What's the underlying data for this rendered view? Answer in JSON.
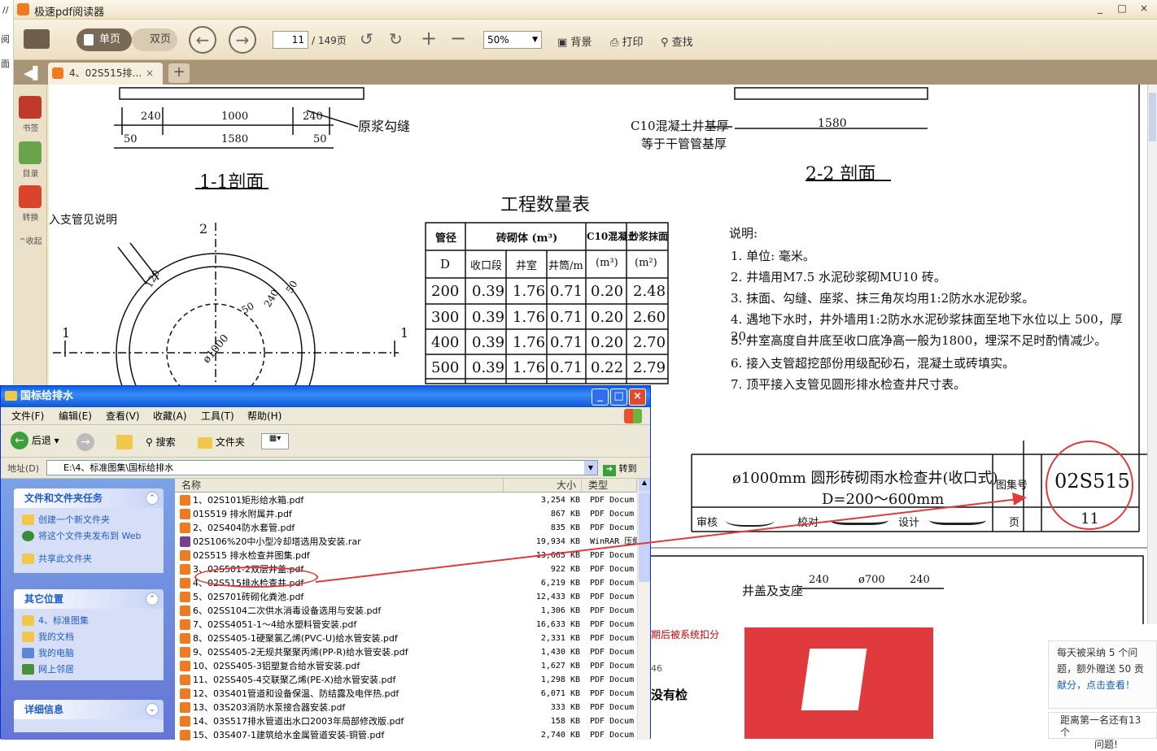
{
  "left_strip": {
    "chars": [
      "//",
      "阅",
      "面"
    ]
  },
  "reader": {
    "title": "极速pdf阅读器",
    "win_controls": [
      "_",
      "□",
      "×"
    ],
    "toolbar": {
      "single": "单页",
      "double": "双页",
      "page_current": "11",
      "page_total": "/ 149页",
      "zoom": "50%",
      "background": "背景",
      "print": "打印",
      "find": "查找"
    },
    "tab": {
      "label": "4、02S515排…",
      "close": "×",
      "add": "+"
    },
    "sidebar": [
      {
        "label": "书签"
      },
      {
        "label": "目录"
      },
      {
        "label": "转换"
      }
    ],
    "sidebar_collapse": "^收起"
  },
  "drawing": {
    "dims_left": [
      "240",
      "1000",
      "240",
      "50",
      "1580",
      "50"
    ],
    "left_note": "原浆勾缝",
    "left_section": "1-1剖面",
    "right_note1": "C10混凝土井基厚",
    "right_note2": "等于干管管基厚",
    "right_dim": "1580",
    "right_section": "2-2 剖面",
    "table_title": "工程数量表",
    "table_head": [
      "管径",
      "砖砌体 (m³)",
      "C10混凝土",
      "砂浆抹面"
    ],
    "table_sub": [
      "D",
      "收口段",
      "井室",
      "井筒/m",
      "(m³)",
      "(m²)"
    ],
    "table_rows": [
      [
        "200",
        "0.39",
        "1.76",
        "0.71",
        "0.20",
        "2.48"
      ],
      [
        "300",
        "0.39",
        "1.76",
        "0.71",
        "0.20",
        "2.60"
      ],
      [
        "400",
        "0.39",
        "1.76",
        "0.71",
        "0.20",
        "2.70"
      ],
      [
        "500",
        "0.39",
        "1.76",
        "0.71",
        "0.22",
        "2.79"
      ]
    ],
    "notes_title": "说明:",
    "notes": [
      "1. 单位: 毫米。",
      "2. 井墙用M7.5 水泥砂浆砌MU10 砖。",
      "3. 抹面、勾缝、座浆、抹三角灰均用1:2防水水泥砂浆。",
      "4. 遇地下水时，井外墙用1:2防水水泥砂浆抹面至地下水位以上 500，厚20。",
      "5. 井室高度自井底至收口底净高一般为1800，埋深不足时酌情减少。",
      "6. 接入支管超挖部份用级配砂石，混凝土或砖填实。",
      "7. 顶平接入支管见圆形排水检查井尺寸表。"
    ],
    "branch_note": "入支管见说明",
    "marks": [
      "1",
      "1",
      "2"
    ],
    "plan_labels": [
      "ø1000",
      "50",
      "240",
      "50",
      "30",
      "120"
    ],
    "titleblock": {
      "name": "ø1000mm 圆形砖砌雨水检查井(收口式)",
      "range": "D=200～600mm",
      "atlas_label": "图集号",
      "atlas_no": "02S515",
      "review": "审核",
      "check": "校对",
      "design": "设计",
      "page_label": "页",
      "page_no": "11"
    },
    "next_page": {
      "label": "井盖及支座",
      "dims": [
        "240",
        "ø700",
        "240"
      ]
    }
  },
  "explorer": {
    "title": "国标给排水",
    "menu": [
      "文件(F)",
      "编辑(E)",
      "查看(V)",
      "收藏(A)",
      "工具(T)",
      "帮助(H)"
    ],
    "back": "后退",
    "search": "搜索",
    "folders": "文件夹",
    "addr_label": "地址(D)",
    "addr_value": "E:\\4、标准图集\\国标给排水",
    "go": "转到",
    "tasks_title": "文件和文件夹任务",
    "tasks": [
      "创建一个新文件夹",
      "将这个文件夹发布到 Web",
      "共享此文件夹"
    ],
    "places_title": "其它位置",
    "places": [
      "4、标准图集",
      "我的文档",
      "我的电脑",
      "网上邻居"
    ],
    "details_title": "详细信息",
    "cols": [
      "名称",
      "大小",
      "类型"
    ],
    "files": [
      {
        "name": "1、02S101矩形给水箱.pdf",
        "size": "3,254 KB",
        "type": "PDF Docum"
      },
      {
        "name": "01S519 排水附属井.pdf",
        "size": "867 KB",
        "type": "PDF Docum"
      },
      {
        "name": "2、02S404防水套管.pdf",
        "size": "835 KB",
        "type": "PDF Docum"
      },
      {
        "name": "02S106%20中小型冷却塔选用及安装.rar",
        "size": "19,934 KB",
        "type": "WinRAR 压缩"
      },
      {
        "name": "02S515 排水检查井图集.pdf",
        "size": "13,665 KB",
        "type": "PDF Docum"
      },
      {
        "name": "3、02S501-2双层井盖.pdf",
        "size": "922 KB",
        "type": "PDF Docum"
      },
      {
        "name": "4、02S515排水检查井.pdf",
        "size": "6,219 KB",
        "type": "PDF Docum"
      },
      {
        "name": "5、02S701砖砌化粪池.pdf",
        "size": "12,433 KB",
        "type": "PDF Docum"
      },
      {
        "name": "6、02SS104二次供水消毒设备选用与安装.pdf",
        "size": "1,306 KB",
        "type": "PDF Docum"
      },
      {
        "name": "7、02SS4051-1～4给水塑料管安装.pdf",
        "size": "16,633 KB",
        "type": "PDF Docum"
      },
      {
        "name": "8、02SS405-1硬聚氯乙烯(PVC-U)给水管安装.pdf",
        "size": "2,331 KB",
        "type": "PDF Docum"
      },
      {
        "name": "9、02SS405-2无规共聚聚丙烯(PP-R)给水管安装.pdf",
        "size": "1,430 KB",
        "type": "PDF Docum"
      },
      {
        "name": "10、02SS405-3铝塑复合给水管安装.pdf",
        "size": "1,627 KB",
        "type": "PDF Docum"
      },
      {
        "name": "11、02SS405-4交联聚乙烯(PE-X)给水管安装.pdf",
        "size": "1,298 KB",
        "type": "PDF Docum"
      },
      {
        "name": "12、03S401管道和设备保温、防结露及电伴热.pdf",
        "size": "6,071 KB",
        "type": "PDF Docum"
      },
      {
        "name": "13、03S203消防水泵接合器安装.pdf",
        "size": "333 KB",
        "type": "PDF Docum"
      },
      {
        "name": "14、03S517排水管道出水口2003年局部修改版.pdf",
        "size": "158 KB",
        "type": "PDF Docum"
      },
      {
        "name": "15、03S407-1建筑给水金属管道安装-铜管.pdf",
        "size": "2,740 KB",
        "type": "PDF Docum"
      }
    ]
  },
  "background": {
    "line1": "期后被系统扣分",
    "num": "46",
    "q": "没有检",
    "promo": [
      "每天被采纳 5 个问",
      "题，额外赠送 50 贡",
      "献分，点击查看！"
    ],
    "promo2": [
      "距离第一名还有13个",
      "问题!"
    ]
  }
}
